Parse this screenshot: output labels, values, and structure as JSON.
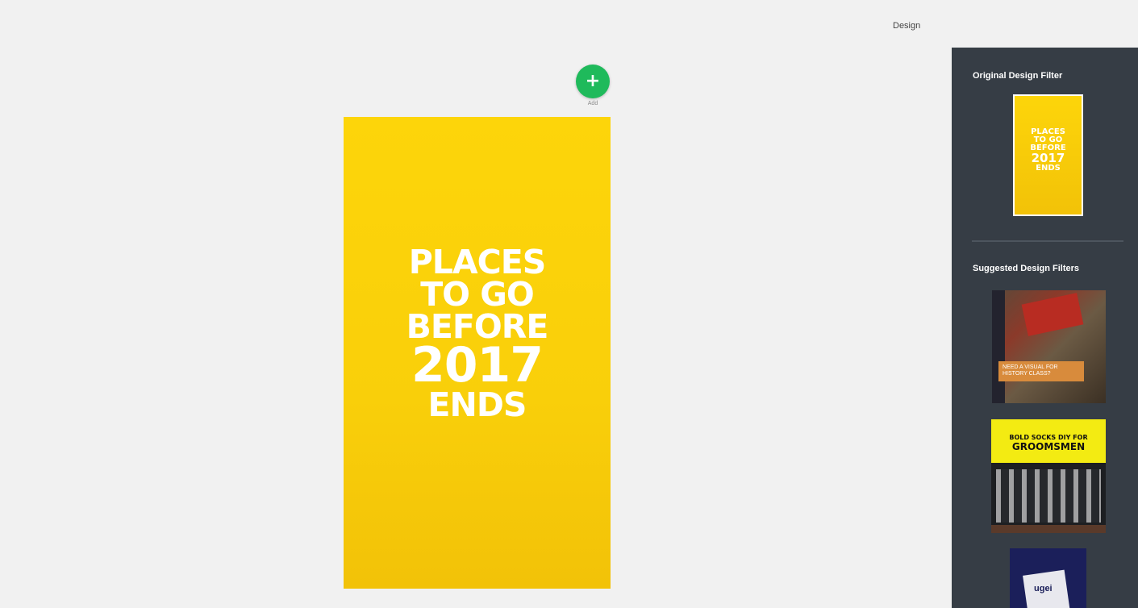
{
  "header": {
    "design_label": "Design"
  },
  "add_button": {
    "icon": "plus-icon",
    "glyph": "+",
    "label": "Add"
  },
  "canvas": {
    "headline_lines": [
      "PLACES",
      "TO GO",
      "BEFORE",
      "2017",
      "ENDS"
    ],
    "background_color": "#fdd50a",
    "text_color": "#ffffff"
  },
  "sidebar": {
    "original_title": "Original Design Filter",
    "original_thumb_lines": [
      "PLACES",
      "TO GO",
      "BEFORE",
      "2017",
      "ENDS"
    ],
    "suggested_title": "Suggested Design Filters",
    "suggestions": [
      {
        "caption": "NEED A VISUAL FOR HISTORY CLASS?"
      },
      {
        "line1": "BOLD SOCKS DIY FOR",
        "line2": "GROOMSMEN"
      },
      {
        "caption": "ugei"
      }
    ],
    "background_color": "#363d45"
  },
  "colors": {
    "accent_green": "#1fba5b",
    "page_bg": "#f1f1f1"
  }
}
